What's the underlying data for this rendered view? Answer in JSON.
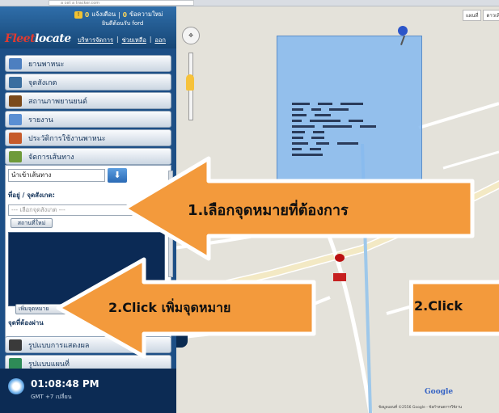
{
  "browser": {
    "address": "a cet a tracker.com"
  },
  "header": {
    "alerts_count": "0",
    "alerts_label": "แจ้งเตือน",
    "messages_count": "0",
    "messages_label": "ข้อความใหม่",
    "welcome": "ยินดีต้อนรับ ford",
    "logo_main": "Fleet",
    "logo_accent": "locate",
    "links": [
      "บริหารจัดการ",
      "ช่วยเหลือ",
      "ออก"
    ]
  },
  "sidebar": {
    "menu": [
      {
        "label": "ยานพาหนะ",
        "icon": "vehicle-icon"
      },
      {
        "label": "จุดสังเกต",
        "icon": "place-icon"
      },
      {
        "label": "สถานภาพยานยนต์",
        "icon": "status-icon"
      },
      {
        "label": "รายงาน",
        "icon": "report-icon"
      },
      {
        "label": "ประวัติการใช้งานพาหนะ",
        "icon": "history-icon"
      },
      {
        "label": "จัดการเส้นทาง",
        "icon": "route-icon"
      }
    ],
    "route_panel": {
      "mode_value": "นำเข้าเส้นทาง",
      "destination_label": "ที่อยู่ / จุดสังเกต:",
      "destination_placeholder": "--- เลือกจุดสังเกต ---",
      "new_place_button": "สถานที่ใหม่",
      "add_destination_button": "เพิ่มจุดหมาย",
      "via_label": "จุดที่ต้องผ่าน"
    },
    "bottom_menu": [
      {
        "label": "รูปแบบการแสดงผล",
        "icon": "display-icon"
      },
      {
        "label": "รูปแบบแผนที่",
        "icon": "map-style-icon"
      }
    ],
    "clock": "01:08:48 PM",
    "timezone": "GMT +7 เปลี่ยน"
  },
  "map": {
    "map_types": [
      "แผนที่",
      "ดาวเทียม"
    ],
    "google_logo": "Google",
    "terms": "ข้อมูลแผนที่ ©2556 Google - ข้อกำหนดการใช้งาน"
  },
  "annotations": {
    "step1": "1.เลือกจุดหมายที่ต้องการ",
    "step2": "2.Click เพิ่มจุดหมาย",
    "step2_dup": "2.Click",
    "arrow_fill": "#f39a3c",
    "arrow_stroke": "#ffffff"
  },
  "colors": {
    "sidebar": "#1d4f86",
    "info_window": "#85b9ee"
  }
}
